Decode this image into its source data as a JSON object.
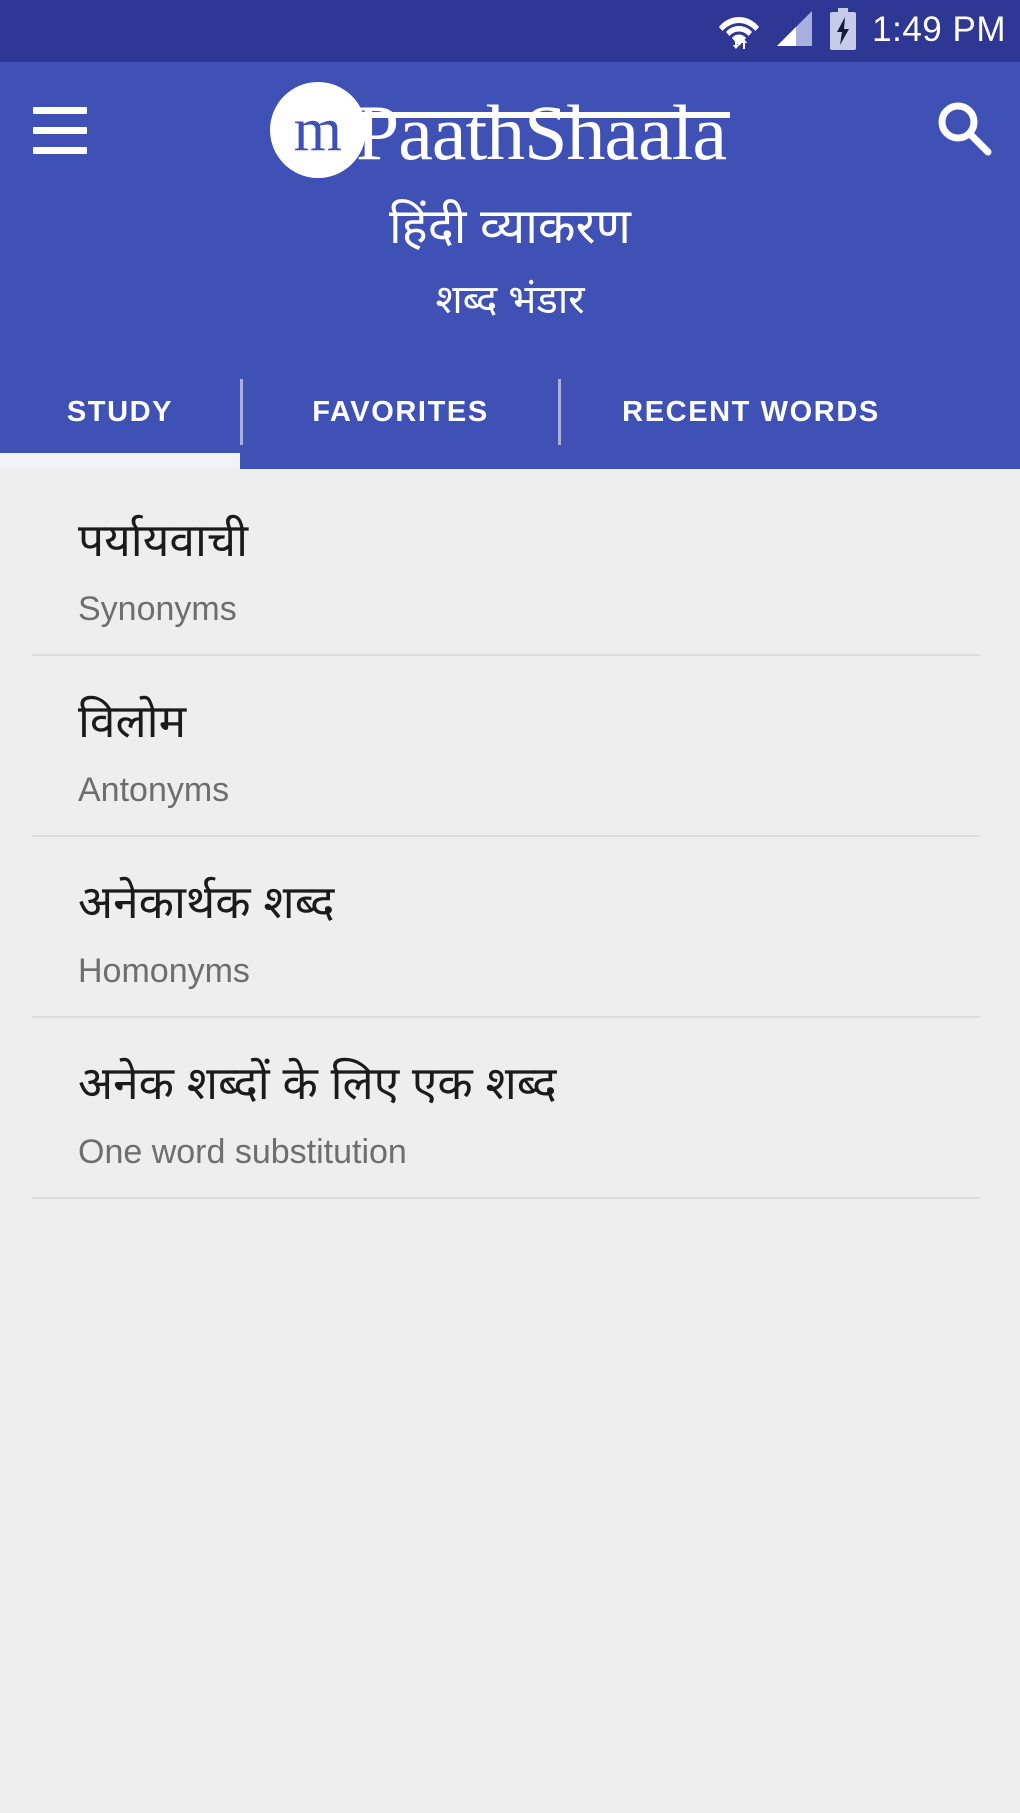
{
  "status_bar": {
    "time": "1:49 PM",
    "icons": [
      "wifi-icon",
      "cellular-signal-icon",
      "battery-charging-icon"
    ]
  },
  "app_bar": {
    "menu_icon": "hamburger-menu-icon",
    "brand_badge": "m",
    "brand_name": "PaathShaala",
    "search_icon": "search-icon",
    "title": "हिंदी व्याकरण",
    "subtitle": "शब्द भंडार",
    "background_color": "#3F51B5",
    "status_bar_color": "#2F3795"
  },
  "tabs": {
    "active_index": 0,
    "items": [
      {
        "label": "STUDY"
      },
      {
        "label": "FAVORITES"
      },
      {
        "label": "RECENT WORDS"
      }
    ]
  },
  "list": {
    "items": [
      {
        "title": "पर्यायवाची",
        "subtitle": "Synonyms"
      },
      {
        "title": "विलोम",
        "subtitle": "Antonyms"
      },
      {
        "title": "अनेकार्थक शब्द",
        "subtitle": "Homonyms"
      },
      {
        "title": "अनेक शब्दों के लिए एक शब्द",
        "subtitle": "One word substitution"
      }
    ]
  }
}
